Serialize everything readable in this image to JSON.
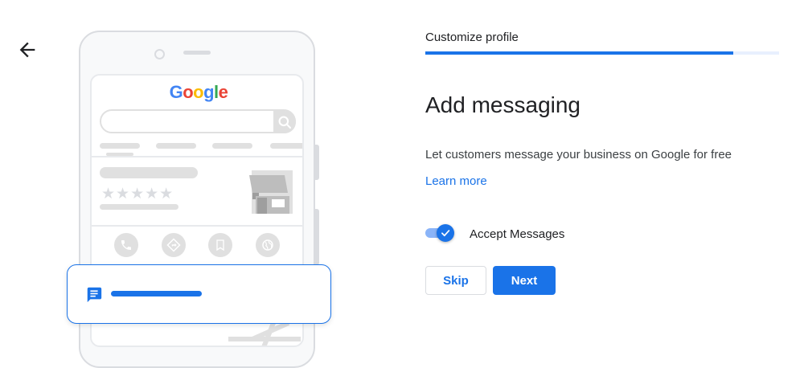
{
  "header": {
    "back_icon": "arrow-back-icon",
    "step_label": "Customize profile",
    "progress": 0.87
  },
  "illustration": {
    "logo_letters": [
      {
        "char": "G",
        "color": "#4285F4"
      },
      {
        "char": "o",
        "color": "#EA4335"
      },
      {
        "char": "o",
        "color": "#FBBC05"
      },
      {
        "char": "g",
        "color": "#4285F4"
      },
      {
        "char": "l",
        "color": "#34A853"
      },
      {
        "char": "e",
        "color": "#EA4335"
      }
    ],
    "stars": "★★★★★",
    "action_icons": [
      "phone-icon",
      "directions-icon",
      "bookmark-icon",
      "globe-icon"
    ],
    "message_icon": "chat-icon"
  },
  "main": {
    "heading": "Add messaging",
    "description": "Let customers message your business on Google for free",
    "learn_more": "Learn more",
    "accept_messages": {
      "label": "Accept Messages",
      "checked": true
    }
  },
  "actions": {
    "skip_label": "Skip",
    "next_label": "Next"
  },
  "colors": {
    "accent": "#1a73e8",
    "track": "#8ab4f8",
    "muted": "#e0e0e0"
  }
}
